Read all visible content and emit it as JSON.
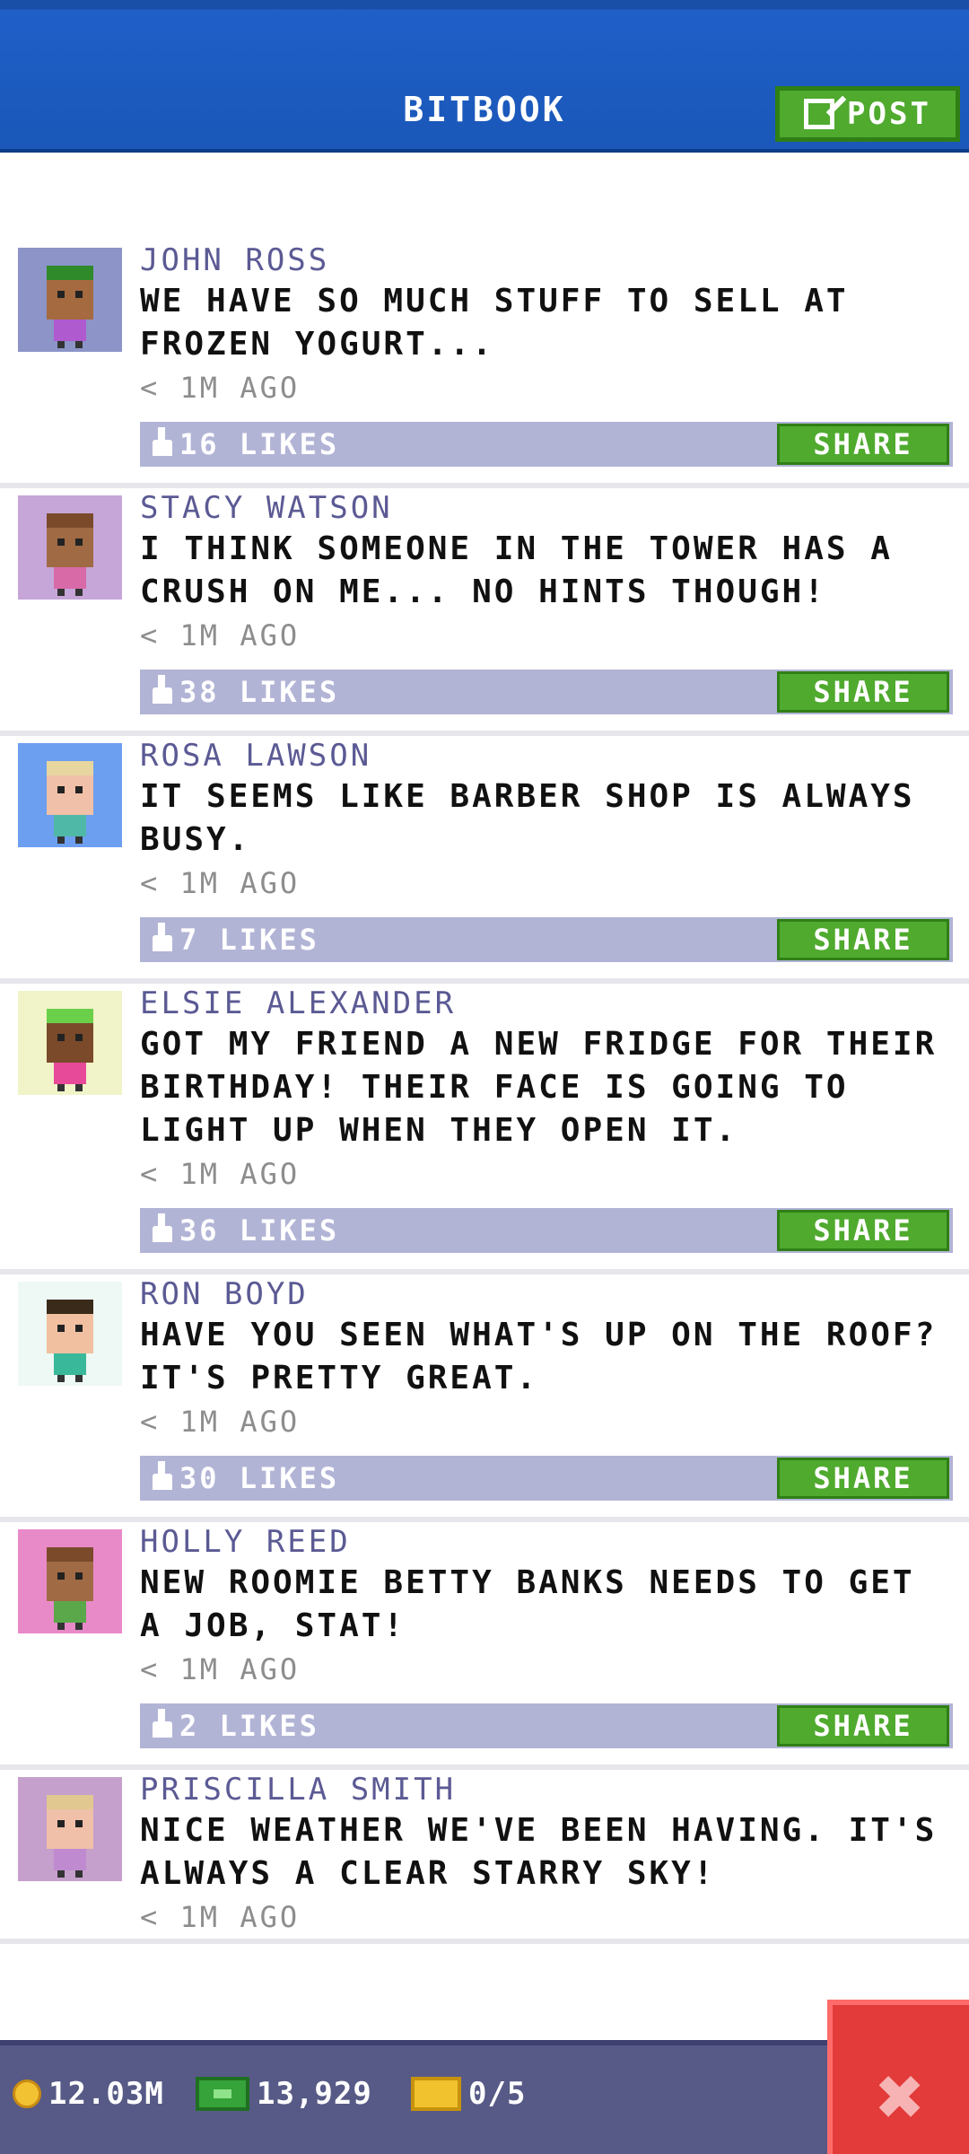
{
  "header": {
    "title": "BITBOOK",
    "post_label": "POST"
  },
  "posts": [
    {
      "name": "JOHN ROSS",
      "text": "WE HAVE SO MUCH STUFF TO SELL AT FROZEN YOGURT...",
      "time": "< 1M AGO",
      "likes": "16 LIKES",
      "share": "SHARE",
      "avatar_bg": "#8c94c8",
      "skin": "#a56a3f",
      "hat": "#2f8a2a",
      "shirt": "#b05ad0"
    },
    {
      "name": "STACY WATSON",
      "text": "I THINK SOMEONE IN THE TOWER HAS A CRUSH ON ME... NO HINTS THOUGH!",
      "time": "< 1M AGO",
      "likes": "38 LIKES",
      "share": "SHARE",
      "avatar_bg": "#c6a6d8",
      "skin": "#a06a45",
      "hat": "#7a4a2a",
      "shirt": "#d86aa8"
    },
    {
      "name": "ROSA LAWSON",
      "text": "IT SEEMS LIKE BARBER SHOP IS ALWAYS BUSY.",
      "time": "< 1M AGO",
      "likes": "7 LIKES",
      "share": "SHARE",
      "avatar_bg": "#6c9ff0",
      "skin": "#f0c0a8",
      "hat": "#e8d6a0",
      "shirt": "#4fb8a6"
    },
    {
      "name": "ELSIE ALEXANDER",
      "text": "GOT MY FRIEND A NEW FRIDGE FOR THEIR BIRTHDAY! THEIR FACE IS GOING TO LIGHT UP WHEN THEY OPEN IT.",
      "time": "< 1M AGO",
      "likes": "36 LIKES",
      "share": "SHARE",
      "avatar_bg": "#f0f4c8",
      "skin": "#7a4a2a",
      "hat": "#6ad04a",
      "shirt": "#e84a9a"
    },
    {
      "name": "RON BOYD",
      "text": "HAVE YOU SEEN WHAT'S UP ON THE ROOF? IT'S PRETTY GREAT.",
      "time": "< 1M AGO",
      "likes": "30 LIKES",
      "share": "SHARE",
      "avatar_bg": "#eef8f4",
      "skin": "#f0c0a0",
      "hat": "#3a2a1a",
      "shirt": "#3ab89a"
    },
    {
      "name": "HOLLY REED",
      "text": "NEW ROOMIE BETTY BANKS NEEDS TO GET A JOB, STAT!",
      "time": "< 1M AGO",
      "likes": "2 LIKES",
      "share": "SHARE",
      "avatar_bg": "#e88ac8",
      "skin": "#a06a45",
      "hat": "#7a4a2a",
      "shirt": "#5aa84a"
    },
    {
      "name": "PRISCILLA SMITH",
      "text": "NICE WEATHER WE'VE BEEN HAVING. IT'S ALWAYS A CLEAR STARRY SKY!",
      "time": "< 1M AGO",
      "likes": "",
      "share": "",
      "avatar_bg": "#c6a0cc",
      "skin": "#f0c0a8",
      "hat": "#e0c890",
      "shirt": "#c08ad0"
    }
  ],
  "status": {
    "coins": "12.03M",
    "cash": "13,929",
    "tickets": "0/5"
  },
  "colors": {
    "header_blue": "#1a57b8",
    "button_green": "#4faa2e",
    "name_purple": "#5b5a94",
    "bar_lavender": "#b2b4d6",
    "bottom_bar": "#575a86",
    "close_red": "#e33a3a"
  }
}
